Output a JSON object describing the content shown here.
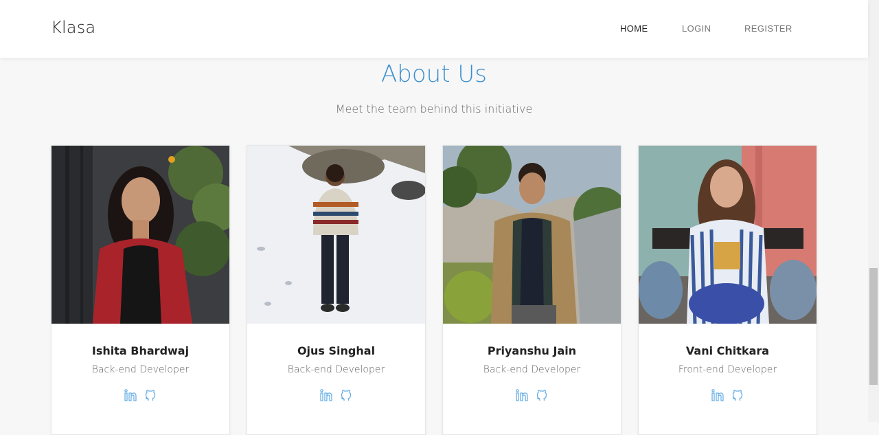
{
  "brand": "Klasa",
  "nav": {
    "home": "HOME",
    "login": "LOGIN",
    "register": "REGISTER"
  },
  "section": {
    "title": "About Us",
    "subtitle": "Meet the team behind this initiative"
  },
  "team": [
    {
      "name": "Ishita Bhardwaj",
      "role": "Back-end Developer"
    },
    {
      "name": "Ojus Singhal",
      "role": "Back-end Developer"
    },
    {
      "name": "Priyanshu Jain",
      "role": "Back-end Developer"
    },
    {
      "name": "Vani Chitkara",
      "role": "Front-end Developer"
    }
  ],
  "icons": {
    "linkedin": "linkedin-icon",
    "github": "github-icon"
  },
  "colors": {
    "accent": "#3a8fd0",
    "icon": "#6ab0e6"
  }
}
